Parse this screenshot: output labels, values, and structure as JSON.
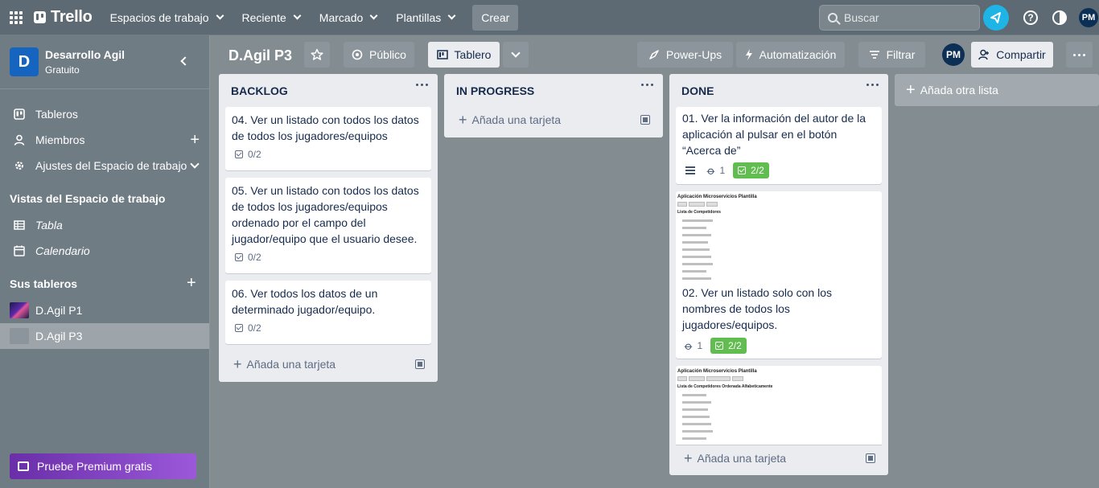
{
  "topbar": {
    "logo": "Trello",
    "nav": [
      {
        "label": "Espacios de trabajo"
      },
      {
        "label": "Reciente"
      },
      {
        "label": "Marcado"
      },
      {
        "label": "Plantillas"
      }
    ],
    "create_label": "Crear",
    "search_placeholder": "Buscar",
    "user_initials": "PM"
  },
  "sidebar": {
    "workspace_initial": "D",
    "workspace_name": "Desarrollo Agil",
    "workspace_plan": "Gratuito",
    "items": [
      {
        "label": "Tableros"
      },
      {
        "label": "Miembros"
      },
      {
        "label": "Ajustes del Espacio de trabajo"
      }
    ],
    "views_heading": "Vistas del Espacio de trabajo",
    "views": [
      {
        "label": "Tabla"
      },
      {
        "label": "Calendario"
      }
    ],
    "boards_heading": "Sus tableros",
    "boards": [
      {
        "label": "D.Agil P1",
        "color": "#3a2a7a"
      },
      {
        "label": "D.Agil P3",
        "color": "#8c959b"
      }
    ],
    "premium_label": "Pruebe Premium gratis"
  },
  "board": {
    "title": "D.Agil P3",
    "visibility": "Público",
    "view_label": "Tablero",
    "powerups": "Power-Ups",
    "automation": "Automatización",
    "filter": "Filtrar",
    "member_initials": "PM",
    "share": "Compartir"
  },
  "lists": [
    {
      "title": "BACKLOG",
      "cards": [
        {
          "text": "04. Ver un listado con todos los datos de todos los jugadores/equipos",
          "checklist": "0/2"
        },
        {
          "text": "05. Ver un listado con todos los datos de todos los jugadores/equipos ordenado por el campo del jugador/equipo que el usuario desee.",
          "checklist": "0/2"
        },
        {
          "text": "06. Ver todos los datos de un determinado jugador/equipo.",
          "checklist": "0/2"
        }
      ],
      "add_card": "Añada una tarjeta"
    },
    {
      "title": "IN PROGRESS",
      "cards": [],
      "add_card": "Añada una tarjeta"
    },
    {
      "title": "DONE",
      "cards": [
        {
          "text": "01. Ver la información del autor de la aplicación al pulsar en el botón “Acerca de”",
          "attachments": "1",
          "checklist": "2/2"
        },
        {
          "text": "02. Ver un listado solo con los nombres de todos los jugadores/equipos.",
          "attachments": "1",
          "checklist": "2/2",
          "preview_title": "Aplicación Microservicios Plantilla",
          "preview_subtitle": "Lista de Competidores"
        },
        {
          "preview_title": "Aplicación Microservicios Plantilla",
          "preview_subtitle": "Lista de Competidores Ordenada Alfabeticamente"
        }
      ],
      "add_card": "Añada una tarjeta"
    }
  ],
  "add_list": "Añada otra lista"
}
